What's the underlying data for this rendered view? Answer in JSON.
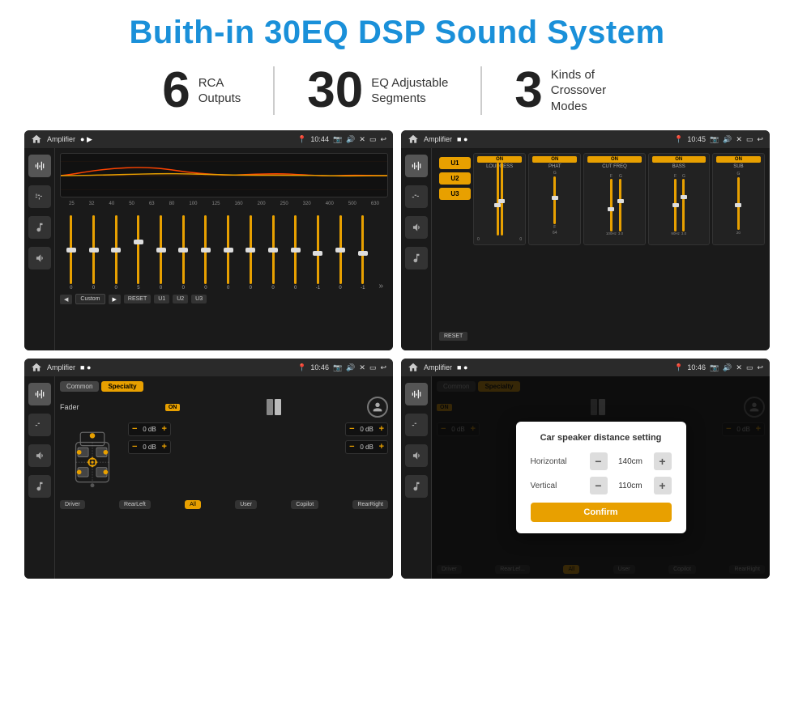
{
  "page": {
    "title": "Buith-in 30EQ DSP Sound System",
    "background": "#ffffff"
  },
  "stats": [
    {
      "number": "6",
      "label": "RCA\nOutputs"
    },
    {
      "number": "30",
      "label": "EQ Adjustable\nSegments"
    },
    {
      "number": "3",
      "label": "Kinds of\nCrossover Modes"
    }
  ],
  "screens": {
    "eq": {
      "title": "Amplifier",
      "time": "10:44",
      "freq_labels": [
        "25",
        "32",
        "40",
        "50",
        "63",
        "80",
        "100",
        "125",
        "160",
        "200",
        "250",
        "320",
        "400",
        "500",
        "630"
      ],
      "values": [
        "0",
        "0",
        "0",
        "5",
        "0",
        "0",
        "0",
        "0",
        "0",
        "0",
        "0",
        "-1",
        "0",
        "-1"
      ],
      "bottom_labels": [
        "Custom",
        "RESET",
        "U1",
        "U2",
        "U3"
      ]
    },
    "crossover": {
      "title": "Amplifier",
      "time": "10:45",
      "presets": [
        "U1",
        "U2",
        "U3"
      ],
      "controls": [
        "LOUDNESS",
        "PHAT",
        "CUT FREQ",
        "BASS",
        "SUB"
      ],
      "reset_label": "RESET"
    },
    "fader": {
      "title": "Amplifier",
      "time": "10:46",
      "tabs": [
        "Common",
        "Specialty"
      ],
      "fader_label": "Fader",
      "on_label": "ON",
      "db_values": [
        "0 dB",
        "0 dB",
        "0 dB",
        "0 dB"
      ],
      "seat_labels": [
        "Driver",
        "RearLeft",
        "All",
        "User",
        "RearRight",
        "Copilot"
      ]
    },
    "distance": {
      "title": "Amplifier",
      "time": "10:46",
      "tabs": [
        "Common",
        "Specialty"
      ],
      "on_label": "ON",
      "dialog": {
        "title": "Car speaker distance setting",
        "horizontal_label": "Horizontal",
        "horizontal_value": "140cm",
        "vertical_label": "Vertical",
        "vertical_value": "110cm",
        "confirm_label": "Confirm"
      },
      "db_values": [
        "0 dB",
        "0 dB"
      ],
      "seat_labels": [
        "Driver",
        "RearLef...",
        "All",
        "User",
        "RearRight",
        "Copilot"
      ]
    }
  }
}
